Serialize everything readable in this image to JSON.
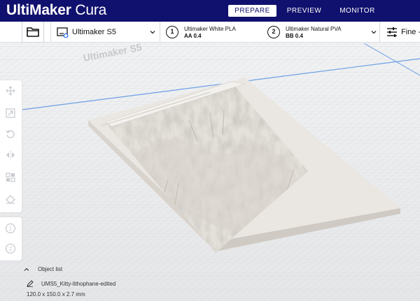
{
  "app": {
    "brand_bold": "UltiMaker",
    "brand_light": "Cura"
  },
  "stages": [
    {
      "label": "PREPARE",
      "active": true
    },
    {
      "label": "PREVIEW",
      "active": false
    },
    {
      "label": "MONITOR",
      "active": false
    }
  ],
  "toolbar": {
    "open_icon": "folder-icon",
    "machine_name": "Ultimaker S5",
    "extruders": [
      {
        "number": "1",
        "material": "Ultimaker White PLA",
        "core": "AA 0.4"
      },
      {
        "number": "2",
        "material": "Ultimaker Natural PVA",
        "core": "BB 0.4"
      }
    ],
    "print_settings": "Fine -"
  },
  "viewport": {
    "build_plate_text": "Ultimaker S5"
  },
  "tools": [
    "move-icon",
    "scale-icon",
    "rotate-icon",
    "mirror-icon",
    "per-model-settings-icon",
    "support-blocker-icon"
  ],
  "extruder_buttons": [
    "1",
    "2"
  ],
  "object_list": {
    "header": "Object list",
    "object_name": "UMS5_Kitty-lithophane-edited",
    "dimensions": "120.0 x 150.0 x 2.7 mm"
  },
  "colors": {
    "titlebar": "#10106e",
    "accent": "#196ef0",
    "plate": "#e9eaec"
  }
}
